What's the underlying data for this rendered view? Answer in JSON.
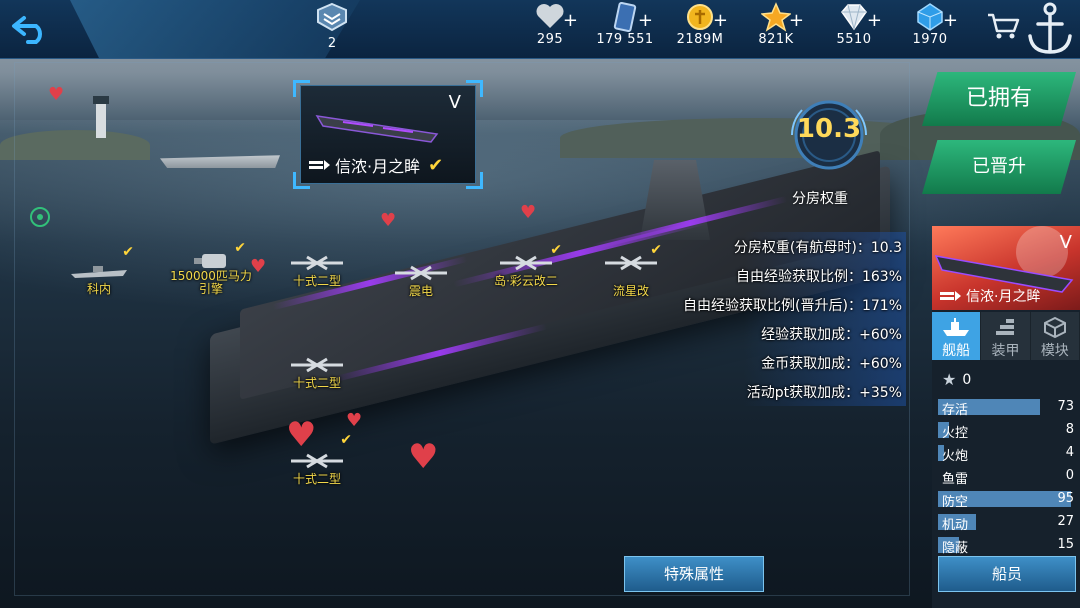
{
  "topbar": {
    "rank_value": "2",
    "resources": [
      {
        "icon": "heart-icon",
        "value": "295"
      },
      {
        "icon": "card-icon",
        "value": "179 551"
      },
      {
        "icon": "gold-coin-icon",
        "value": "2189M"
      },
      {
        "icon": "star-icon",
        "value": "821K"
      },
      {
        "icon": "silver-diamond-icon",
        "value": "5510"
      },
      {
        "icon": "blue-diamond-icon",
        "value": "1970"
      }
    ]
  },
  "selected_ship": {
    "tier": "V",
    "name": "信浓·月之眸"
  },
  "rating": {
    "value": "10.3",
    "label": "分房权重"
  },
  "aircraft": [
    {
      "name": "科内"
    },
    {
      "name": "150000匹马力引擎"
    },
    {
      "name": "十式二型"
    },
    {
      "name": "震电"
    },
    {
      "name": "岛·彩云改二"
    },
    {
      "name": "流星改"
    },
    {
      "name": "十式二型"
    },
    {
      "name": "十式二型"
    }
  ],
  "stat_lines": [
    {
      "text": "分房权重(有航母时)：10.3"
    },
    {
      "text": "自由经验获取比例：163%"
    },
    {
      "text": "自由经验获取比例(晋升后)：171%"
    },
    {
      "text": "经验获取加成：+60%"
    },
    {
      "text": "金币获取加成：+60%"
    },
    {
      "text": "活动pt获取加成：+35%"
    }
  ],
  "special_button": "特殊属性",
  "owned_button": "已拥有",
  "promoted_button": "已晋升",
  "panel": {
    "tier": "V",
    "name": "信浓·月之眸",
    "tabs": [
      {
        "label": "舰船",
        "icon": "ship-icon",
        "active": true
      },
      {
        "label": "装甲",
        "icon": "armor-icon",
        "active": false
      },
      {
        "label": "模块",
        "icon": "module-icon",
        "active": false
      }
    ],
    "star_count": "0",
    "stats": [
      {
        "label": "存活",
        "value": "73",
        "fill": 0.73
      },
      {
        "label": "火控",
        "value": "8",
        "fill": 0.08
      },
      {
        "label": "火炮",
        "value": "4",
        "fill": 0.04
      },
      {
        "label": "鱼雷",
        "value": "0",
        "fill": 0.0
      },
      {
        "label": "防空",
        "value": "95",
        "fill": 0.95
      },
      {
        "label": "机动",
        "value": "27",
        "fill": 0.27
      },
      {
        "label": "隐蔽",
        "value": "15",
        "fill": 0.15
      }
    ],
    "crew_button": "船员"
  }
}
